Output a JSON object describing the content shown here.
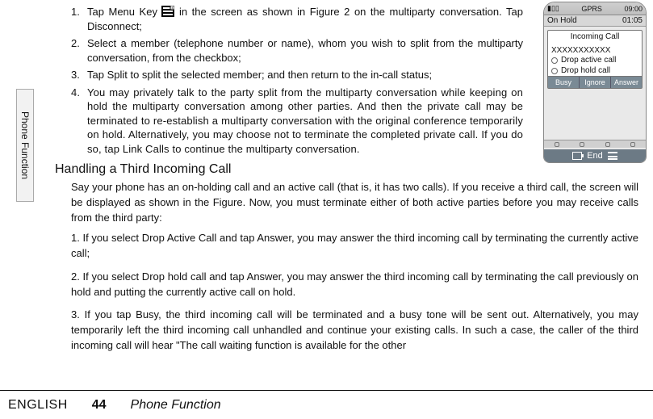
{
  "sideTab": "Phone Function",
  "list1": {
    "i1_num": "1.",
    "i1_txt_a": "Tap Menu Key ",
    "i1_txt_b": " in the screen as shown in Figure 2 on the multiparty conversation. Tap Disconnect;",
    "i2_num": "2.",
    "i2_txt": "Select a member (telephone number or name), whom you wish to split from the multiparty conversation, from the checkbox;",
    "i3_num": "3.",
    "i3_txt": "Tap Split to split the selected member; and then return to the in-call status;",
    "i4_num": "4.",
    "i4_txt": "You may privately talk to the party split from the multiparty conversation while keeping on hold the multiparty conversation among other parties. And then the private call may be terminated to re-establish a multiparty conversation with the original conference temporarily on hold. Alternatively, you may choose not to terminate the completed private call. If you do so, tap Link Calls to continue the multiparty conversation."
  },
  "subhead": "Handling a Third Incoming Call",
  "para": "Say your phone has an on-holding call and an active call (that is, it has two calls). If you receive a third call, the screen will be displayed as shown in the Figure. Now, you must terminate either of both active parties before you may receive calls from the third party:",
  "list2": {
    "i1": "1. If you select Drop Active Call and tap Answer, you may answer the third incoming call by terminating the currently active call;",
    "i2": "2. If you select Drop hold call and tap Answer, you may answer the third incoming call by terminating the call previously on hold and putting the currently active call on hold.",
    "i3": "3. If you tap Busy, the third incoming call will be terminated and a busy tone will be sent out. Alternatively, you may temporarily left the third incoming call unhandled and continue your existing calls. In such a case, the caller of the third incoming call will hear \"The call waiting function is available for the other"
  },
  "figure": {
    "status_left": "GPRS",
    "status_right": "09:00",
    "onhold_label": "On Hold",
    "onhold_time": "01:05",
    "popup_title": "Incoming Call",
    "popup_number": "XXXXXXXXXXX",
    "opt1": "Drop active call",
    "opt2": "Drop hold call",
    "btn_busy": "Busy",
    "btn_ignore": "Ignore",
    "btn_answer": "Answer",
    "endbar": "End"
  },
  "footer": {
    "lang": "ENGLISH",
    "page": "44",
    "section": "Phone Function"
  },
  "icons": {
    "menu_key": "menu-key-icon"
  }
}
